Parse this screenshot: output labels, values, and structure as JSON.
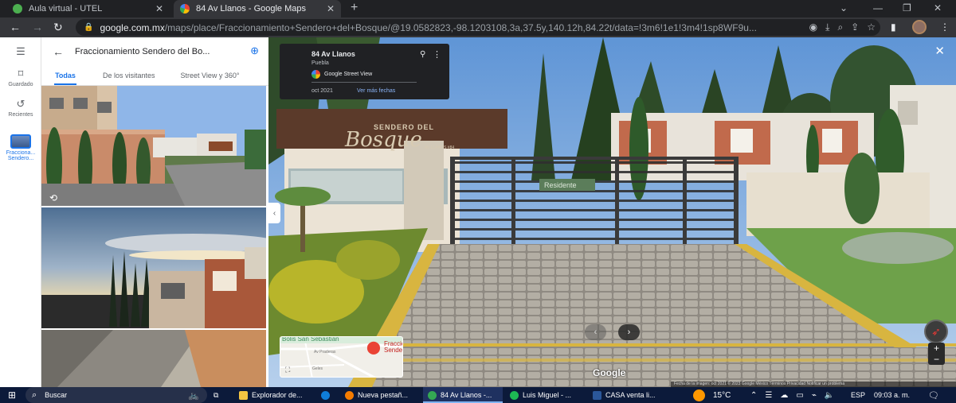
{
  "browser": {
    "tabs": [
      {
        "title": "Aula virtual - UTEL",
        "favicon_color": "#4caf50"
      },
      {
        "title": "84 Av Llanos - Google Maps",
        "favicon_color": "#34a853"
      }
    ],
    "new_tab_label": "+",
    "url_host": "google.com.mx",
    "url_path": "/maps/place/Fraccionamiento+Sendero+del+Bosque/@19.0582823,-98.1203108,3a,37.5y,140.12h,84.22t/data=!3m6!1e1!3m4!1sp8WF9u..."
  },
  "rail": {
    "saved_label": "Guardado",
    "recent_label": "Recientes",
    "place_label_1": "Fracciona...",
    "place_label_2": "Sendero..."
  },
  "panel": {
    "title": "Fraccionamiento Sendero del Bo...",
    "tabs": [
      "Todas",
      "De los visitantes",
      "Street View y 360°"
    ]
  },
  "streetview": {
    "address": "84 Av Llanos",
    "city": "Puebla",
    "provider": "Google Street View",
    "date": "oct 2021",
    "more_dates": "Ver más fechas",
    "sign_line1": "SENDERO DEL",
    "sign_line2": "Bosque",
    "sign_address": "AV LLANOS #84",
    "gate_label": "Residente",
    "watermark": "Google",
    "footer": "Fecha de la imagen: oct 2021   © 2023 Google   México   Términos   Privacidad   Notificar un problema",
    "minimap_place": "Fraccio Sendero",
    "minimap_area": "Bolis San Sebastián",
    "minimap_street1": "Av Praderas",
    "minimap_street2": "Geles",
    "zoom_in": "+",
    "zoom_out": "−"
  },
  "taskbar": {
    "search_label": "Buscar",
    "apps": [
      {
        "label": "Explorador de...",
        "color": "#f4c542"
      },
      {
        "label": "",
        "color": "#0f7dd8"
      },
      {
        "label": "Nueva pestañ...",
        "color": "#f57c00"
      },
      {
        "label": "84 Av Llanos -...",
        "color": "#34a853"
      },
      {
        "label": "Luis Miguel - ...",
        "color": "#1db954"
      },
      {
        "label": "CASA venta li...",
        "color": "#2b579a"
      }
    ],
    "temperature": "15°C",
    "language": "ESP",
    "time": "09:03 a. m."
  }
}
